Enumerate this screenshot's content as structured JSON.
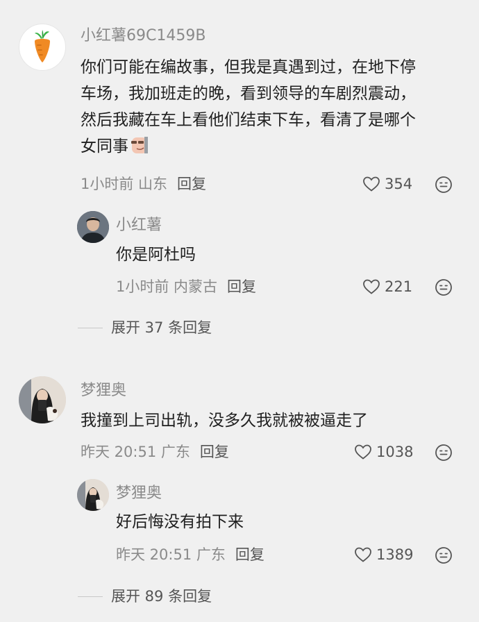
{
  "comments": [
    {
      "username": "小红薯69C1459B",
      "lines": [
        "你们可能在编故事，但我是真遇到过，在地下停",
        "车场，我加班走的晚，看到领导的车剧烈震动，",
        "然后我藏在车上看他们结束下车，看清了是哪个",
        "女同事"
      ],
      "meta": "1小时前 山东",
      "reply_label": "回复",
      "likes": "354",
      "reply": {
        "username": "小红薯",
        "text": "你是阿杜吗",
        "meta": "1小时前 内蒙古",
        "reply_label": "回复",
        "likes": "221"
      },
      "expand_label": "展开 37 条回复"
    },
    {
      "username": "梦狸奥",
      "lines": [
        "我撞到上司出轨，没多久我就被被逼走了"
      ],
      "meta": "昨天 20:51 广东",
      "reply_label": "回复",
      "likes": "1038",
      "reply": {
        "username": "梦狸奥",
        "text": "好后悔没有拍下来",
        "meta": "昨天 20:51 广东",
        "reply_label": "回复",
        "likes": "1389"
      },
      "expand_label": "展开 89 条回复"
    }
  ],
  "icons": {
    "like": "heart-outline-icon",
    "emoji": "emoji-face-icon",
    "avatar1": "carrot-avatar",
    "inline_emoji": "smirk-sticker-emoji"
  },
  "colors": {
    "background": "#f0f0f0",
    "username": "#8a8a8a",
    "text": "#1f1f1f",
    "carrot": "#f08a24",
    "carrot_leaf": "#3bb54a"
  }
}
